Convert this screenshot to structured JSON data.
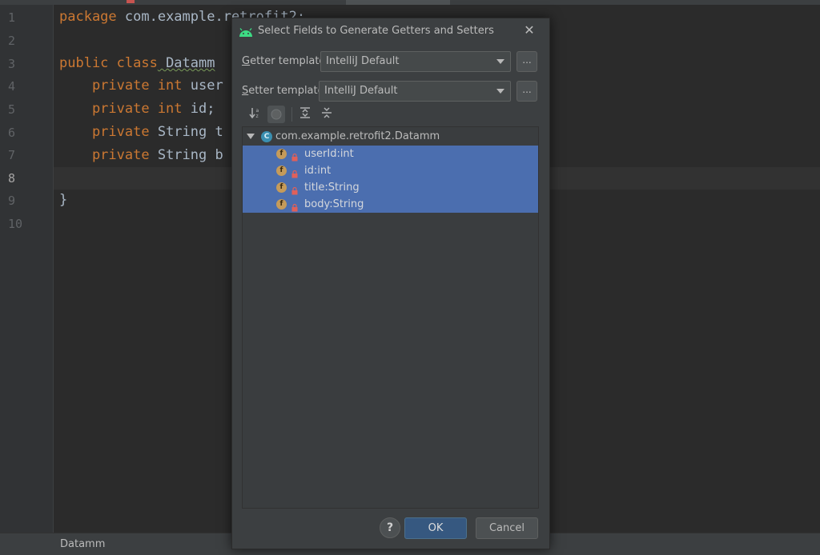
{
  "editor": {
    "line_numbers": [
      "1",
      "2",
      "3",
      "4",
      "5",
      "6",
      "7",
      "8",
      "9",
      "10"
    ],
    "current_line": "8",
    "lines": [
      {
        "kw": "package",
        "rest": " com.example.retrofit2;"
      },
      {
        "kw": "",
        "rest": ""
      },
      {
        "kw": "public class",
        "rest": " Datamm"
      },
      {
        "kw": "    private int",
        "rest": " user"
      },
      {
        "kw": "    private int",
        "rest": " id;"
      },
      {
        "kw": "    private",
        "rest": " String t"
      },
      {
        "kw": "    private",
        "rest": " String b"
      },
      {
        "kw": "",
        "rest": ""
      },
      {
        "kw": "",
        "rest": "}"
      },
      {
        "kw": "",
        "rest": ""
      }
    ]
  },
  "status_bar": {
    "breadcrumb": "Datamm"
  },
  "dialog": {
    "title": "Select Fields to Generate Getters and Setters",
    "close_icon": "close-icon",
    "getter": {
      "label_mnemonic": "G",
      "label_rest": "etter template:",
      "value": "IntelliJ Default",
      "more": "..."
    },
    "setter": {
      "label_mnemonic": "S",
      "label_rest": "etter template:",
      "value": "IntelliJ Default",
      "more": "..."
    },
    "toolbar": [
      "sort-alpha-icon",
      "show-inherited-icon",
      "expand-all-icon",
      "collapse-all-icon"
    ],
    "tree": {
      "root": "com.example.retrofit2.Datamm",
      "root_icon_letter": "C",
      "field_icon_letter": "f",
      "fields": [
        "userId:int",
        "id:int",
        "title:String",
        "body:String"
      ]
    },
    "help": "?",
    "ok": "OK",
    "cancel": "Cancel"
  },
  "colors": {
    "selection": "#4b6eaf",
    "keyword": "#cc7832",
    "ok_button": "#365880"
  }
}
